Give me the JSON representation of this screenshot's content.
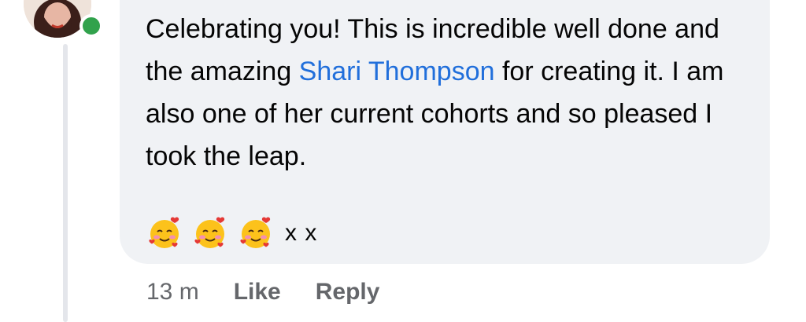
{
  "comment": {
    "text_before_mention": "Celebrating you! This is incredible well done and the amazing ",
    "mention": "Shari Thompson",
    "text_after_mention": " for creating it. I am also one of her current cohorts and so pleased I took the leap.",
    "emoji_icons": [
      "smiling-face-with-hearts-icon",
      "smiling-face-with-hearts-icon",
      "smiling-face-with-hearts-icon"
    ],
    "emoji_tail": "x x"
  },
  "actions": {
    "time": "13 m",
    "like_label": "Like",
    "reply_label": "Reply"
  },
  "colors": {
    "bubble": "#f0f2f5",
    "mention": "#216fdb",
    "online": "#31a24c",
    "meta_text": "#65676b"
  }
}
